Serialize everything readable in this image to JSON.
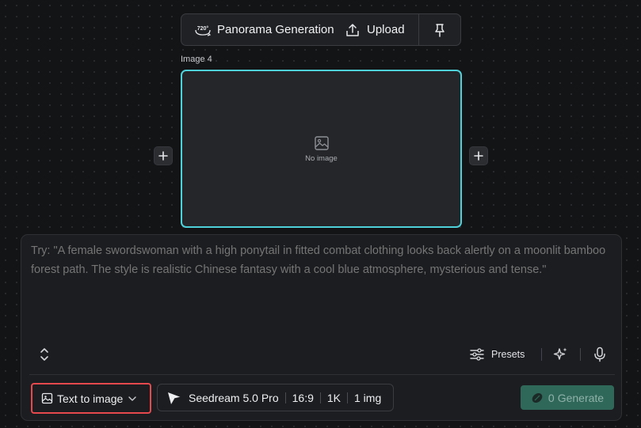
{
  "toolbar": {
    "badge": "720°",
    "panorama_label": "Panorama Generation",
    "upload_label": "Upload",
    "icons": [
      "panorama-720-icon",
      "upload-icon",
      "pin-icon"
    ]
  },
  "image_card": {
    "label": "Image 4",
    "placeholder": "No image",
    "accent_color": "#4fd1d9"
  },
  "prompt": {
    "placeholder": "Try: \"A female swordswoman with a high ponytail in fitted combat clothing looks back alertly on a moonlit bamboo forest path. The style is realistic Chinese fantasy with a cool blue atmosphere, mysterious and tense.\""
  },
  "actions": {
    "presets_label": "Presets"
  },
  "bottom": {
    "mode_label": "Text to image",
    "model_name": "Seedream 5.0 Pro",
    "aspect_ratio": "16:9",
    "resolution": "1K",
    "image_count": "1 img",
    "generate_cost": "0",
    "generate_label": "Generate",
    "highlight_color": "#e5484d",
    "generate_color": "#2f6859"
  }
}
